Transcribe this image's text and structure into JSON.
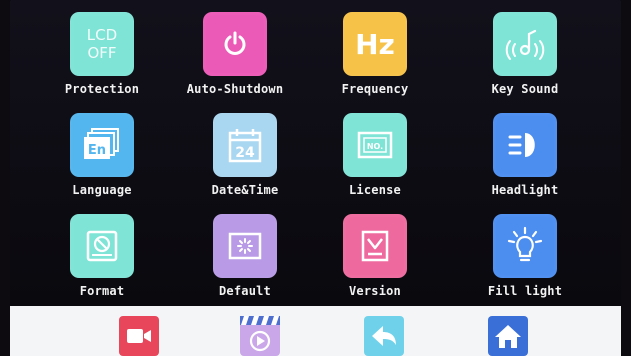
{
  "settings": {
    "items": [
      {
        "label": "Protection",
        "icon": "lcd-off-icon",
        "icon_text": [
          "LCD",
          "OFF"
        ],
        "color": "#7fe4d6"
      },
      {
        "label": "Auto-Shutdown",
        "icon": "power-icon",
        "color": "#ec5ab7"
      },
      {
        "label": "Frequency",
        "icon": "hz-icon",
        "icon_text": [
          "Hz"
        ],
        "color": "#f6c247"
      },
      {
        "label": "Key Sound",
        "icon": "key-sound-icon",
        "color": "#7fe4d6"
      },
      {
        "label": "Language",
        "icon": "language-icon",
        "icon_text": [
          "En"
        ],
        "color": "#53b6ee"
      },
      {
        "label": "Date&Time",
        "icon": "calendar-icon",
        "icon_text": [
          "24"
        ],
        "color": "#a9d6f0"
      },
      {
        "label": "License",
        "icon": "license-icon",
        "icon_text": [
          "NO."
        ],
        "color": "#7fe4d6"
      },
      {
        "label": "Headlight",
        "icon": "headlight-icon",
        "color": "#4c8ef0"
      },
      {
        "label": "Format",
        "icon": "format-icon",
        "color": "#7fe4d6"
      },
      {
        "label": "Default",
        "icon": "default-icon",
        "color": "#b89ae6"
      },
      {
        "label": "Version",
        "icon": "version-icon",
        "color": "#ee6a9e"
      },
      {
        "label": "Fill light",
        "icon": "fill-light-icon",
        "color": "#4c8ef0"
      }
    ]
  },
  "bottom_nav": {
    "items": [
      {
        "icon": "video-camera-icon",
        "color": "#e8465b"
      },
      {
        "icon": "video-playback-icon",
        "color": "#c9a7e8"
      },
      {
        "icon": "back-arrow-icon",
        "color": "#6fd2ea"
      },
      {
        "icon": "home-icon",
        "color": "#3a6fd8"
      }
    ]
  }
}
